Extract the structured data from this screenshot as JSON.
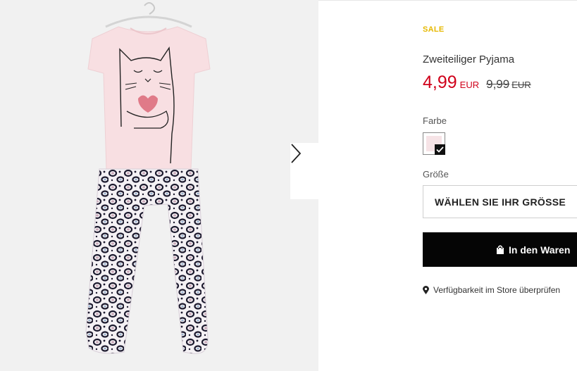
{
  "product": {
    "badge": "SALE",
    "title": "Zweiteiliger Pyjama",
    "price": {
      "current": "4,99",
      "current_currency": "EUR",
      "original": "9,99",
      "original_currency": "EUR"
    },
    "color_label": "Farbe",
    "size_label": "Größe",
    "size_select_placeholder": "WÄHLEN SIE IHR GRÖSSE",
    "add_to_cart_label": "In den Waren",
    "store_availability_label": "Verfügbarkeit im Store überprüfen",
    "swatches": [
      {
        "color": "#f6e3e6",
        "selected": true
      }
    ]
  },
  "colors": {
    "sale": "#e6b800",
    "price_red": "#d0021b",
    "button_bg": "#050505"
  },
  "icons": {
    "next": "chevron-right-icon",
    "bag": "shopping-bag-icon",
    "pin": "location-pin-icon",
    "check": "checkmark-icon"
  }
}
